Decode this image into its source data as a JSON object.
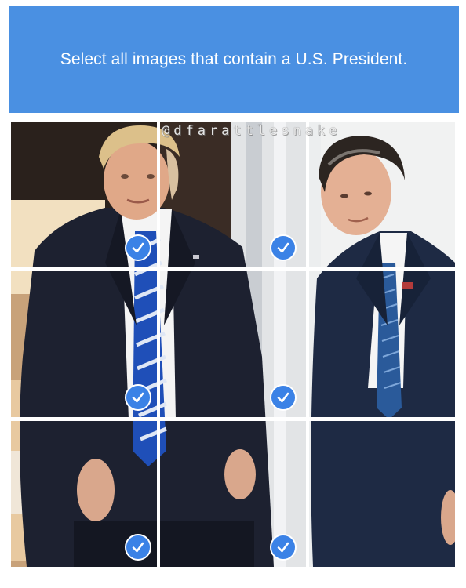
{
  "prompt": {
    "text": "Select all images that contain a U.S. President."
  },
  "watermark": {
    "text": "@dfarattlesnake"
  },
  "colors": {
    "header_bg": "#4a90e2",
    "check_bg": "#3b82e6"
  },
  "tiles": [
    {
      "row": 0,
      "col": 0,
      "selected": true
    },
    {
      "row": 0,
      "col": 1,
      "selected": true
    },
    {
      "row": 0,
      "col": 2,
      "selected": false
    },
    {
      "row": 1,
      "col": 0,
      "selected": true
    },
    {
      "row": 1,
      "col": 1,
      "selected": true
    },
    {
      "row": 1,
      "col": 2,
      "selected": false
    },
    {
      "row": 2,
      "col": 0,
      "selected": true
    },
    {
      "row": 2,
      "col": 1,
      "selected": true
    },
    {
      "row": 2,
      "col": 2,
      "selected": false
    }
  ],
  "icons": {
    "check": "checkmark-icon"
  }
}
